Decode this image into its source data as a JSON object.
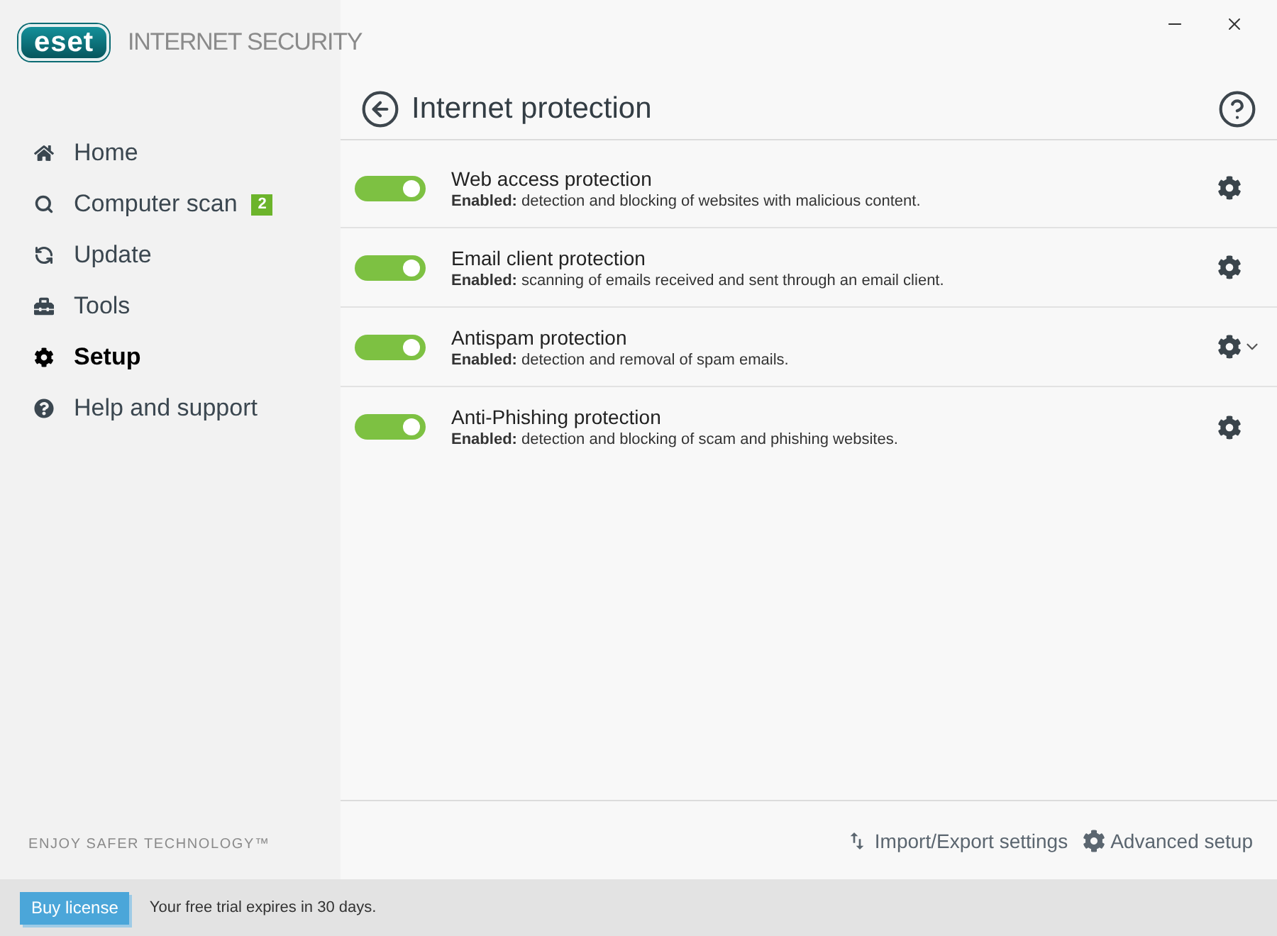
{
  "window": {
    "logo": "eset",
    "product": "INTERNET SECURITY"
  },
  "sidebar": {
    "items": [
      {
        "label": "Home",
        "selected": false
      },
      {
        "label": "Computer scan",
        "selected": false,
        "badge": "2"
      },
      {
        "label": "Update",
        "selected": false
      },
      {
        "label": "Tools",
        "selected": false
      },
      {
        "label": "Setup",
        "selected": true
      },
      {
        "label": "Help and support",
        "selected": false
      }
    ],
    "tagline": "ENJOY SAFER TECHNOLOGY™"
  },
  "page": {
    "title": "Internet protection"
  },
  "modules": [
    {
      "name": "Web access protection",
      "description": "**Enabled:** detection and blocking of websites with malicious content.",
      "on": true,
      "dropdown": false
    },
    {
      "name": "Email client protection",
      "description": "**Enabled:** scanning of emails received and sent through an email client.",
      "on": true,
      "dropdown": false
    },
    {
      "name": "Antispam protection",
      "description": "**Enabled:** detection and removal of spam emails.",
      "on": true,
      "dropdown": true
    },
    {
      "name": "Anti-Phishing protection",
      "description": "**Enabled:** detection and blocking of scam and phishing websites.",
      "on": true,
      "dropdown": false
    }
  ],
  "footer_links": [
    "Import/Export settings",
    "Advanced setup"
  ],
  "status_bar": {
    "button": "Buy license",
    "message": "Your free trial expires in 30 days."
  }
}
